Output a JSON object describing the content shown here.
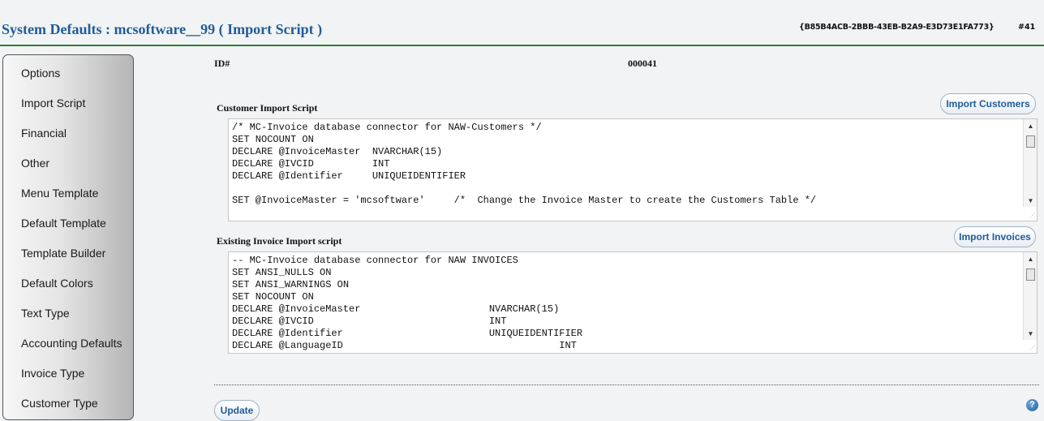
{
  "header": {
    "title": "System Defaults : mcsoftware__99 ( Import Script )",
    "guid": "{B85B4ACB-2BBB-43EB-B2A9-E3D73E1FA773}",
    "record_number": "#41"
  },
  "sidebar": {
    "items": [
      {
        "label": "Options"
      },
      {
        "label": "Import Script"
      },
      {
        "label": "Financial"
      },
      {
        "label": "Other"
      },
      {
        "label": "Menu Template"
      },
      {
        "label": "Default Template"
      },
      {
        "label": "Template Builder"
      },
      {
        "label": "Default Colors"
      },
      {
        "label": "Text Type"
      },
      {
        "label": "Accounting Defaults"
      },
      {
        "label": "Invoice Type"
      },
      {
        "label": "Customer Type"
      }
    ]
  },
  "main": {
    "id_label": "ID#",
    "id_value": "000041",
    "customer_script": {
      "label": "Customer Import Script",
      "button_label": "Import Customers",
      "value": "/* MC-Invoice database connector for NAW-Customers */\nSET NOCOUNT ON\nDECLARE @InvoiceMaster  NVARCHAR(15)\nDECLARE @IVCID          INT\nDECLARE @Identifier     UNIQUEIDENTIFIER\n\nSET @InvoiceMaster = 'mcsoftware'     /*  Change the Invoice Master to create the Customers Table */"
    },
    "invoice_script": {
      "label": "Existing Invoice Import script",
      "button_label": "Import Invoices",
      "value": "-- MC-Invoice database connector for NAW INVOICES\nSET ANSI_NULLS ON\nSET ANSI_WARNINGS ON\nSET NOCOUNT ON\nDECLARE @InvoiceMaster                      NVARCHAR(15)\nDECLARE @IVCID                              INT\nDECLARE @Identifier                         UNIQUEIDENTIFIER\nDECLARE @LanguageID                                     INT"
    },
    "update_label": "Update",
    "help_glyph": "?"
  },
  "icons": {
    "scroll_up": "scroll-up-arrow-icon",
    "scroll_down": "scroll-down-arrow-icon",
    "help": "help-icon"
  },
  "colors": {
    "title": "#1f5c99",
    "header_rule": "#2e7d32",
    "button_text": "#1f5c99"
  }
}
